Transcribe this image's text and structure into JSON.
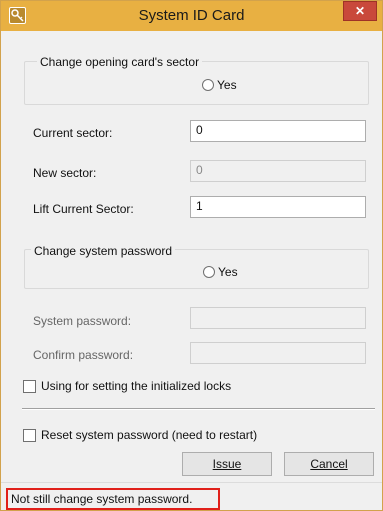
{
  "window": {
    "title": "System ID Card",
    "close_glyph": "✕",
    "app_icon": "key-icon"
  },
  "sector_group": {
    "title": "Change opening card's sector",
    "radio_label": "Yes"
  },
  "sector_fields": {
    "current_label": "Current sector:",
    "current_value": "0",
    "new_label": "New sector:",
    "new_value": "0",
    "lift_label": "Lift Current Sector:",
    "lift_value": "1"
  },
  "password_group": {
    "title": "Change system password",
    "radio_label": "Yes"
  },
  "password_fields": {
    "system_label": "System password:",
    "system_value": "",
    "confirm_label": "Confirm password:",
    "confirm_value": ""
  },
  "checkboxes": {
    "init_locks_label": "Using for setting the initialized locks",
    "reset_label": "Reset system password (need to restart)"
  },
  "buttons": {
    "issue_label": "Issue",
    "cancel_label": "Cancel"
  },
  "status": {
    "message": "Not still change system password.",
    "highlight_color": "#e0201a"
  },
  "colors": {
    "titlebar": "#e8b042",
    "close": "#c9483b"
  }
}
